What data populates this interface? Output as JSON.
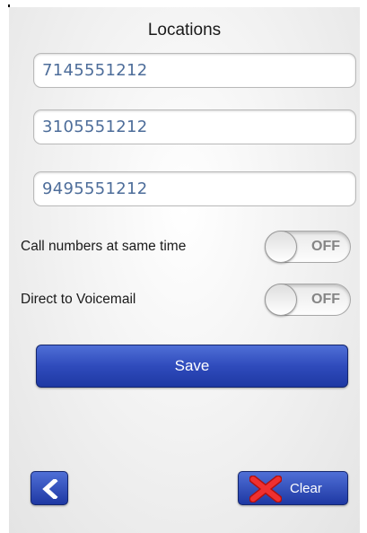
{
  "header": {
    "title": "Locations"
  },
  "locations": [
    {
      "value": "7145551212"
    },
    {
      "value": "3105551212"
    },
    {
      "value": "9495551212"
    }
  ],
  "options": [
    {
      "label": "Call numbers at same time",
      "state": "OFF"
    },
    {
      "label": "Direct to Voicemail",
      "state": "OFF"
    }
  ],
  "actions": {
    "save_label": "Save",
    "clear_label": "Clear"
  },
  "icons": {
    "back": "chevron-left-icon",
    "clear": "red-x-icon"
  },
  "colors": {
    "button_blue": "#2f4bbc",
    "input_text": "#4d6d9a",
    "clear_x": "#e02020"
  }
}
